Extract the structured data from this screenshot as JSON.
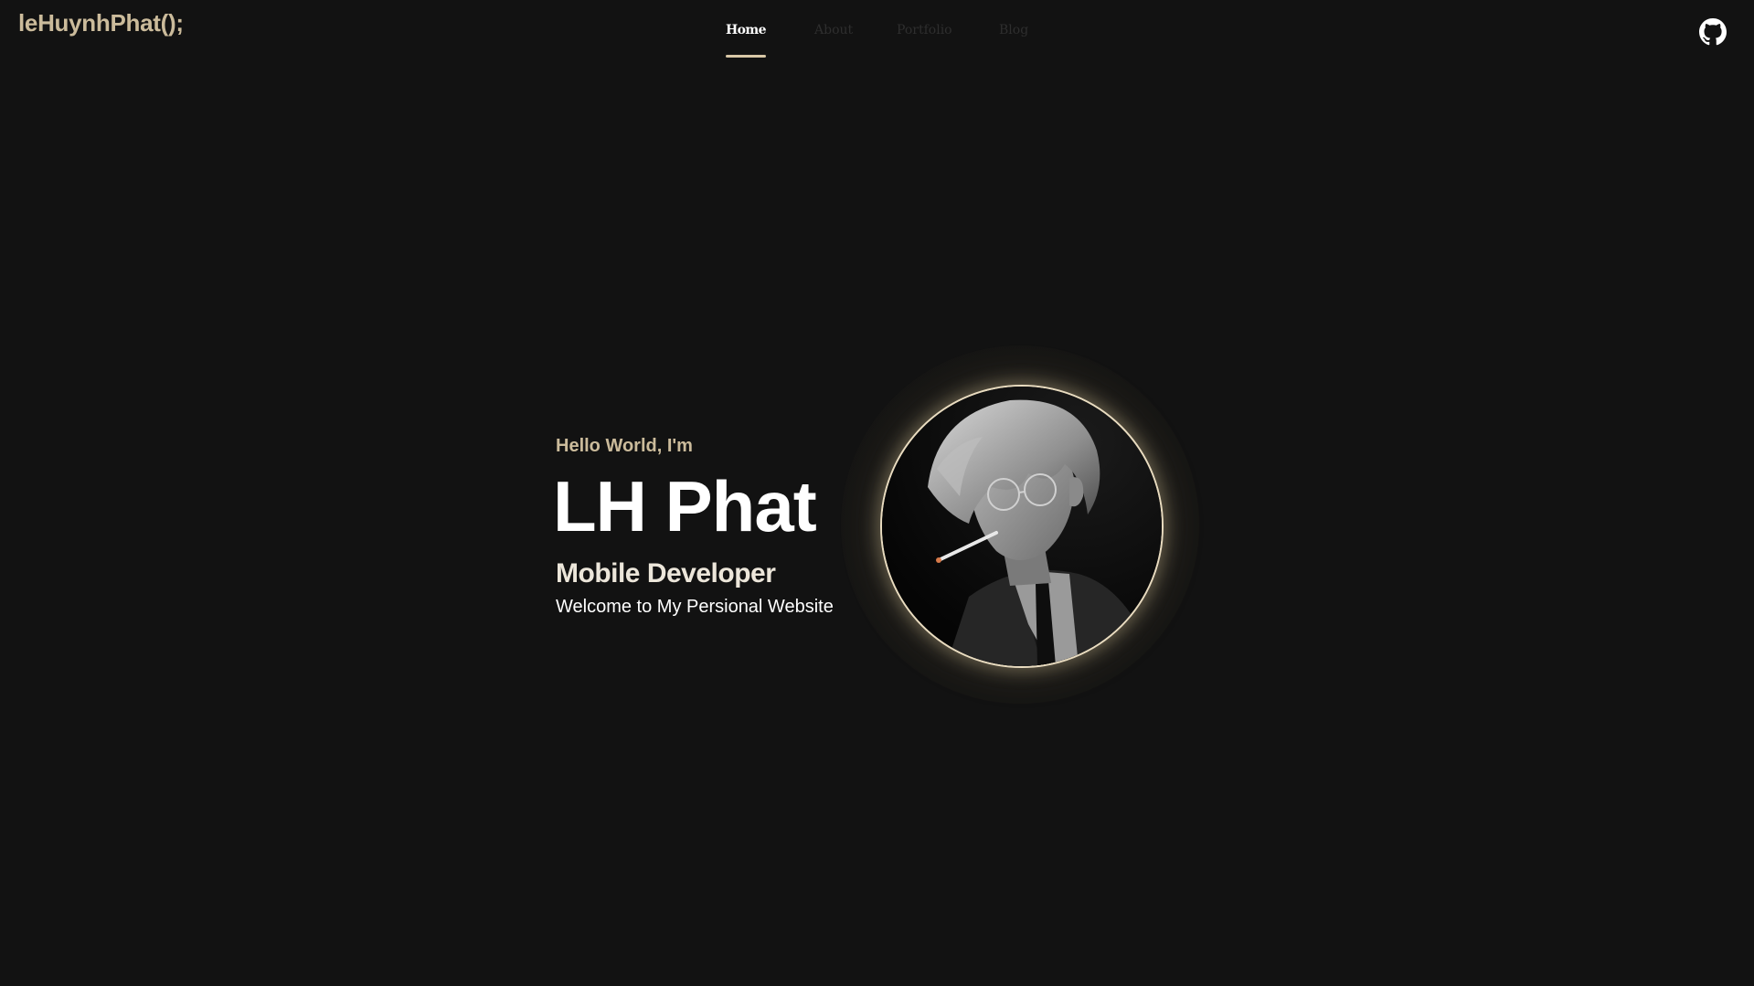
{
  "header": {
    "logo": "leHuynhPhat();",
    "nav": [
      {
        "label": "Home",
        "active": true
      },
      {
        "label": "About",
        "active": false
      },
      {
        "label": "Portfolio",
        "active": false
      },
      {
        "label": "Blog",
        "active": false
      }
    ],
    "github_icon": "github-icon"
  },
  "hero": {
    "greeting": "Hello World, I'm",
    "name": "LH Phat",
    "role": "Mobile Developer",
    "welcome": "Welcome to My Persional Website"
  },
  "colors": {
    "background": "#121212",
    "accent": "#cbbb9b",
    "underline": "#d8c7a6",
    "nav_inactive": "#2e2e2e"
  }
}
